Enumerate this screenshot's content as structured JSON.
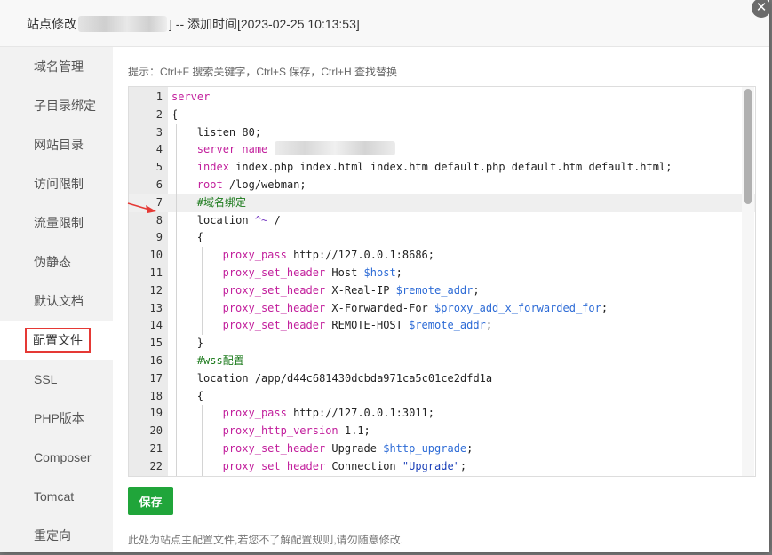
{
  "window": {
    "title_prefix": "站点修改",
    "title_suffix": "] -- 添加时间[2023-02-25 10:13:53]",
    "close_icon": "✕"
  },
  "sidebar": {
    "items": [
      {
        "label": "域名管理"
      },
      {
        "label": "子目录绑定"
      },
      {
        "label": "网站目录"
      },
      {
        "label": "访问限制"
      },
      {
        "label": "流量限制"
      },
      {
        "label": "伪静态"
      },
      {
        "label": "默认文档"
      },
      {
        "label": "配置文件",
        "active": true
      },
      {
        "label": "SSL"
      },
      {
        "label": "PHP版本"
      },
      {
        "label": "Composer"
      },
      {
        "label": "Tomcat"
      },
      {
        "label": "重定向"
      }
    ]
  },
  "hint": "提示：Ctrl+F 搜索关键字，Ctrl+S 保存，Ctrl+H 查找替换",
  "editor": {
    "lines": [
      {
        "n": "1",
        "indent": 0,
        "parts": [
          [
            "kw",
            "server"
          ]
        ]
      },
      {
        "n": "2",
        "indent": 0,
        "parts": [
          [
            "t",
            "{"
          ]
        ]
      },
      {
        "n": "3",
        "indent": 1,
        "parts": [
          [
            "t",
            "listen 80;"
          ]
        ]
      },
      {
        "n": "4",
        "indent": 1,
        "parts": [
          [
            "kw",
            "server_name"
          ]
        ],
        "blur": true
      },
      {
        "n": "5",
        "indent": 1,
        "parts": [
          [
            "kw",
            "index"
          ],
          [
            "t",
            " index.php index.html index.htm default.php default.htm default.html;"
          ]
        ]
      },
      {
        "n": "6",
        "indent": 1,
        "parts": [
          [
            "kw",
            "root"
          ],
          [
            "t",
            " /log/webman;"
          ]
        ]
      },
      {
        "n": "7",
        "indent": 1,
        "parts": [
          [
            "cm",
            "#域名绑定"
          ]
        ],
        "highlight": true
      },
      {
        "n": "8",
        "indent": 1,
        "parts": [
          [
            "t",
            "location "
          ],
          [
            "op",
            "^~"
          ],
          [
            "t",
            " /"
          ]
        ]
      },
      {
        "n": "9",
        "indent": 1,
        "parts": [
          [
            "t",
            "{"
          ]
        ]
      },
      {
        "n": "10",
        "indent": 2,
        "parts": [
          [
            "kw",
            "proxy_pass"
          ],
          [
            "t",
            " http://127.0.0.1:8686;"
          ]
        ]
      },
      {
        "n": "11",
        "indent": 2,
        "parts": [
          [
            "kw",
            "proxy_set_header"
          ],
          [
            "t",
            " Host "
          ],
          [
            "var",
            "$host"
          ],
          [
            "t",
            ";"
          ]
        ]
      },
      {
        "n": "12",
        "indent": 2,
        "parts": [
          [
            "kw",
            "proxy_set_header"
          ],
          [
            "t",
            " X-Real-IP "
          ],
          [
            "var",
            "$remote_addr"
          ],
          [
            "t",
            ";"
          ]
        ]
      },
      {
        "n": "13",
        "indent": 2,
        "parts": [
          [
            "kw",
            "proxy_set_header"
          ],
          [
            "t",
            " X-Forwarded-For "
          ],
          [
            "var",
            "$proxy_add_x_forwarded_for"
          ],
          [
            "t",
            ";"
          ]
        ]
      },
      {
        "n": "14",
        "indent": 2,
        "parts": [
          [
            "kw",
            "proxy_set_header"
          ],
          [
            "t",
            " REMOTE-HOST "
          ],
          [
            "var",
            "$remote_addr"
          ],
          [
            "t",
            ";"
          ]
        ]
      },
      {
        "n": "15",
        "indent": 1,
        "parts": [
          [
            "t",
            "}"
          ]
        ]
      },
      {
        "n": "16",
        "indent": 1,
        "parts": [
          [
            "cm",
            "#wss配置"
          ]
        ]
      },
      {
        "n": "17",
        "indent": 1,
        "parts": [
          [
            "t",
            "location /app/d44c681430dcbda971ca5c01ce2dfd1a"
          ]
        ]
      },
      {
        "n": "18",
        "indent": 1,
        "parts": [
          [
            "t",
            "{"
          ]
        ]
      },
      {
        "n": "19",
        "indent": 2,
        "parts": [
          [
            "kw",
            "proxy_pass"
          ],
          [
            "t",
            " http://127.0.0.1:3011;"
          ]
        ]
      },
      {
        "n": "20",
        "indent": 2,
        "parts": [
          [
            "kw",
            "proxy_http_version"
          ],
          [
            "t",
            " 1.1;"
          ]
        ]
      },
      {
        "n": "21",
        "indent": 2,
        "parts": [
          [
            "kw",
            "proxy_set_header"
          ],
          [
            "t",
            " Upgrade "
          ],
          [
            "var",
            "$http_upgrade"
          ],
          [
            "t",
            ";"
          ]
        ]
      },
      {
        "n": "22",
        "indent": 2,
        "parts": [
          [
            "kw",
            "proxy_set_header"
          ],
          [
            "t",
            " Connection "
          ],
          [
            "str",
            "\"Upgrade\""
          ],
          [
            "t",
            ";"
          ]
        ]
      }
    ]
  },
  "save_label": "保存",
  "footer_note": "此处为站点主配置文件,若您不了解配置规则,请勿随意修改.",
  "colors": {
    "keyword": "#c21f9c",
    "variable": "#2d6bd6",
    "string": "#1a3fb8",
    "comment": "#1b7a1b",
    "operator": "#7a3fc4",
    "text": "#222222",
    "save_button": "#20a53a",
    "arrow": "#e53935",
    "active_border": "#e53935"
  }
}
